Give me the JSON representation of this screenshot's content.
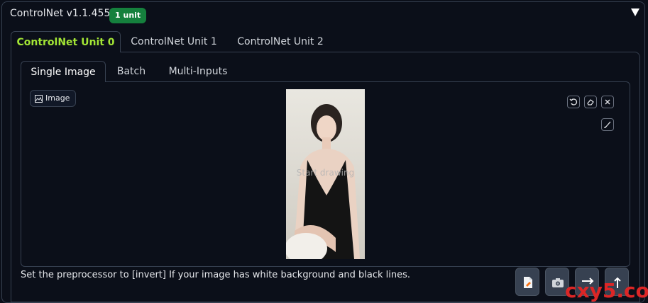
{
  "header": {
    "title": "ControlNet v1.1.455",
    "badge": "1 unit"
  },
  "unit_tabs": [
    {
      "label": "ControlNet Unit 0",
      "active": true
    },
    {
      "label": "ControlNet Unit 1",
      "active": false
    },
    {
      "label": "ControlNet Unit 2",
      "active": false
    }
  ],
  "input_tabs": [
    {
      "label": "Single Image",
      "active": true
    },
    {
      "label": "Batch",
      "active": false
    },
    {
      "label": "Multi-Inputs",
      "active": false
    }
  ],
  "image_input": {
    "label": "Image",
    "overlay_text": "Start drawing"
  },
  "canvas_tools": [
    "undo-icon",
    "eraser-icon",
    "close-icon",
    "brush-icon"
  ],
  "hint": "Set the preprocessor to [invert] If your image has white background and black lines.",
  "actions": [
    "new-canvas-icon",
    "camera-icon",
    "send-dimensions-icon",
    "upload-icon"
  ],
  "watermark": "cxy5.com",
  "colors": {
    "accent_green": "#a3e635",
    "badge_green": "#15803d",
    "background": "#0b0f19",
    "watermark_red": "#dc2626"
  }
}
